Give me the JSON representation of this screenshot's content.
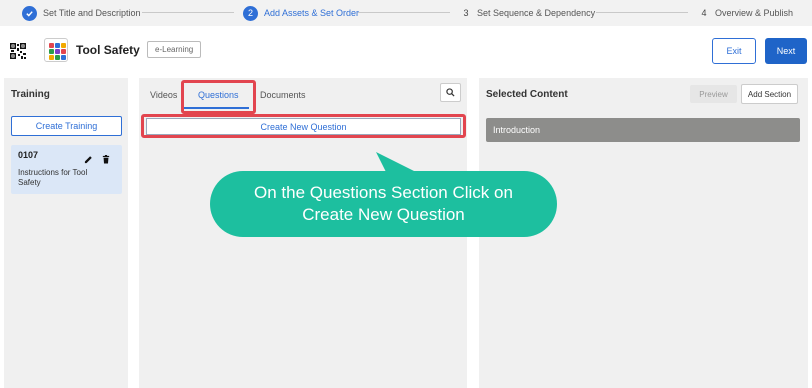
{
  "stepper": {
    "steps": [
      {
        "number": "",
        "label": "Set Title and Description"
      },
      {
        "number": "2",
        "label": "Add Assets & Set Order"
      },
      {
        "number": "3",
        "label": "Set Sequence & Dependency"
      },
      {
        "number": "4",
        "label": "Overview & Publish"
      }
    ]
  },
  "header": {
    "title": "Tool Safety",
    "badge": "e-Learning",
    "exit_label": "Exit",
    "next_label": "Next"
  },
  "training_panel": {
    "title": "Training",
    "create_label": "Create Training",
    "card": {
      "code": "0107",
      "description": "Instructions for Tool Safety"
    }
  },
  "assets_panel": {
    "tabs": [
      {
        "label": "Videos"
      },
      {
        "label": "Questions"
      },
      {
        "label": "Documents"
      }
    ],
    "create_question_label": "Create New Question"
  },
  "selected_panel": {
    "title": "Selected Content",
    "preview_label": "Preview",
    "add_section_label": "Add Section",
    "sections": [
      "Introduction"
    ]
  },
  "callout": {
    "text": "On the Questions Section Click on Create New Question"
  },
  "colors": {
    "accent": "#2f6fd6",
    "highlight": "#e2454f",
    "callout": "#1dbf9f"
  }
}
